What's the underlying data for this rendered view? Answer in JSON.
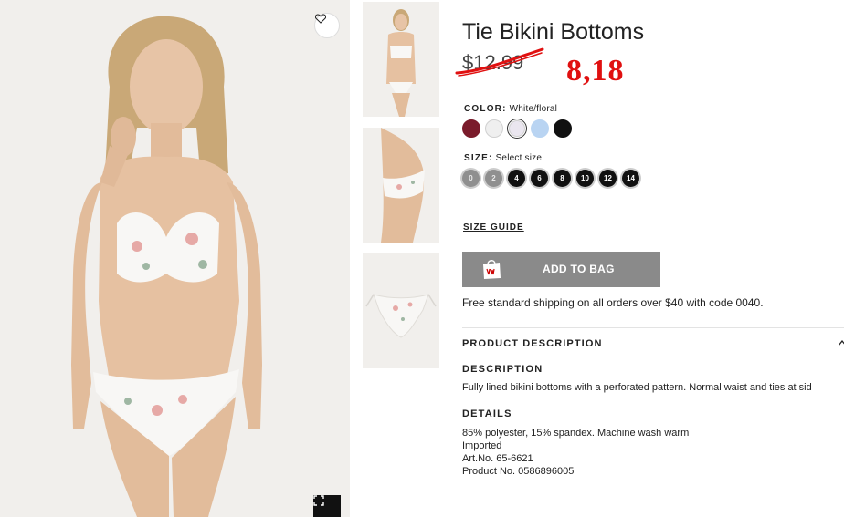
{
  "product": {
    "title": "Tie Bikini Bottoms",
    "price_old": "$12.99",
    "price_new_handwritten": "8,18"
  },
  "icons": {
    "favorite": "heart-icon",
    "expand": "expand-icon",
    "bag": "hm-bag-icon",
    "chevron": "chevron-up-icon"
  },
  "color": {
    "label": "COLOR:",
    "selected_value": "White/floral",
    "swatches": [
      "#7a1b2b",
      "#efefef",
      "#eae6ef",
      "#b9d4f2",
      "#111111"
    ]
  },
  "size": {
    "label": "SIZE:",
    "selected_value": "Select size",
    "options": [
      {
        "label": "0",
        "available": false
      },
      {
        "label": "2",
        "available": false
      },
      {
        "label": "4",
        "available": true
      },
      {
        "label": "6",
        "available": true
      },
      {
        "label": "8",
        "available": true
      },
      {
        "label": "10",
        "available": true
      },
      {
        "label": "12",
        "available": true
      },
      {
        "label": "14",
        "available": true
      }
    ]
  },
  "size_guide": "SIZE GUIDE",
  "add_to_bag": "ADD TO BAG",
  "shipping_note": "Free standard shipping on all orders over $40 with code 0040.",
  "product_description": {
    "header": "PRODUCT DESCRIPTION",
    "description_heading": "DESCRIPTION",
    "description_text": "Fully lined bikini bottoms with a perforated pattern. Normal waist and ties at sid",
    "details_heading": "DETAILS",
    "details": [
      "85% polyester, 15% spandex. Machine wash warm",
      "Imported",
      "Art.No. 65-6621",
      "Product No. 0586896005"
    ]
  },
  "colors": {
    "accent_red": "#e01010",
    "button_gray": "#8a8a8a",
    "text": "#222222"
  }
}
